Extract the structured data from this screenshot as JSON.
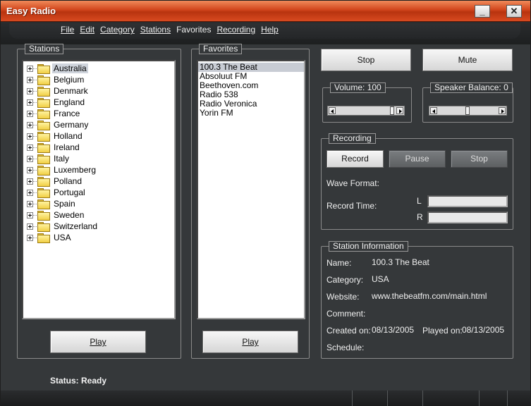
{
  "window": {
    "title": "Easy Radio",
    "minimize_label": "_",
    "close_label": "✕"
  },
  "menu": [
    {
      "label": "File",
      "underline": true
    },
    {
      "label": "Edit",
      "underline": true
    },
    {
      "label": "Category",
      "underline": true
    },
    {
      "label": "Stations",
      "underline": true
    },
    {
      "label": "Favorites",
      "underline": false
    },
    {
      "label": "Recording",
      "underline": true
    },
    {
      "label": "Help",
      "underline": true
    }
  ],
  "stations": {
    "legend": "Stations",
    "items": [
      "Australia",
      "Belgium",
      "Denmark",
      "England",
      "France",
      "Germany",
      "Holland",
      "Ireland",
      "Italy",
      "Luxemberg",
      "Polland",
      "Portugal",
      "Spain",
      "Sweden",
      "Switzerland",
      "USA"
    ],
    "selected": "Australia",
    "play_label": "Play"
  },
  "favorites": {
    "legend": "Favorites",
    "items": [
      "100.3 The Beat",
      "Absoluut FM",
      "Beethoven.com",
      "Radio 538",
      "Radio Veronica",
      "Yorin FM"
    ],
    "selected": "100.3 The Beat",
    "play_label": "Play"
  },
  "controls": {
    "stop_label": "Stop",
    "mute_label": "Mute"
  },
  "volume": {
    "legend": "Volume: 100",
    "level": 1.0
  },
  "balance": {
    "legend": "Speaker Balance: 0",
    "level": 0.5
  },
  "recording": {
    "legend": "Recording",
    "record_label": "Record",
    "pause_label": "Pause",
    "stop_label": "Stop",
    "wave_format_label": "Wave Format:",
    "record_time_label": "Record Time:",
    "left_label": "L",
    "right_label": "R"
  },
  "station_info": {
    "legend": "Station Information",
    "name_label": "Name:",
    "name_value": "100.3 The Beat",
    "category_label": "Category:",
    "category_value": "USA",
    "website_label": "Website:",
    "website_value": "www.thebeatfm.com/main.html",
    "comment_label": "Comment:",
    "created_label": "Created on:",
    "created_value": "08/13/2005",
    "played_label": "Played on:",
    "played_value": "08/13/2005",
    "schedule_label": "Schedule:"
  },
  "status": {
    "text": "Status: Ready"
  },
  "colors": {
    "title_accent": "#d1451c",
    "panel_bg": "#35383a"
  }
}
